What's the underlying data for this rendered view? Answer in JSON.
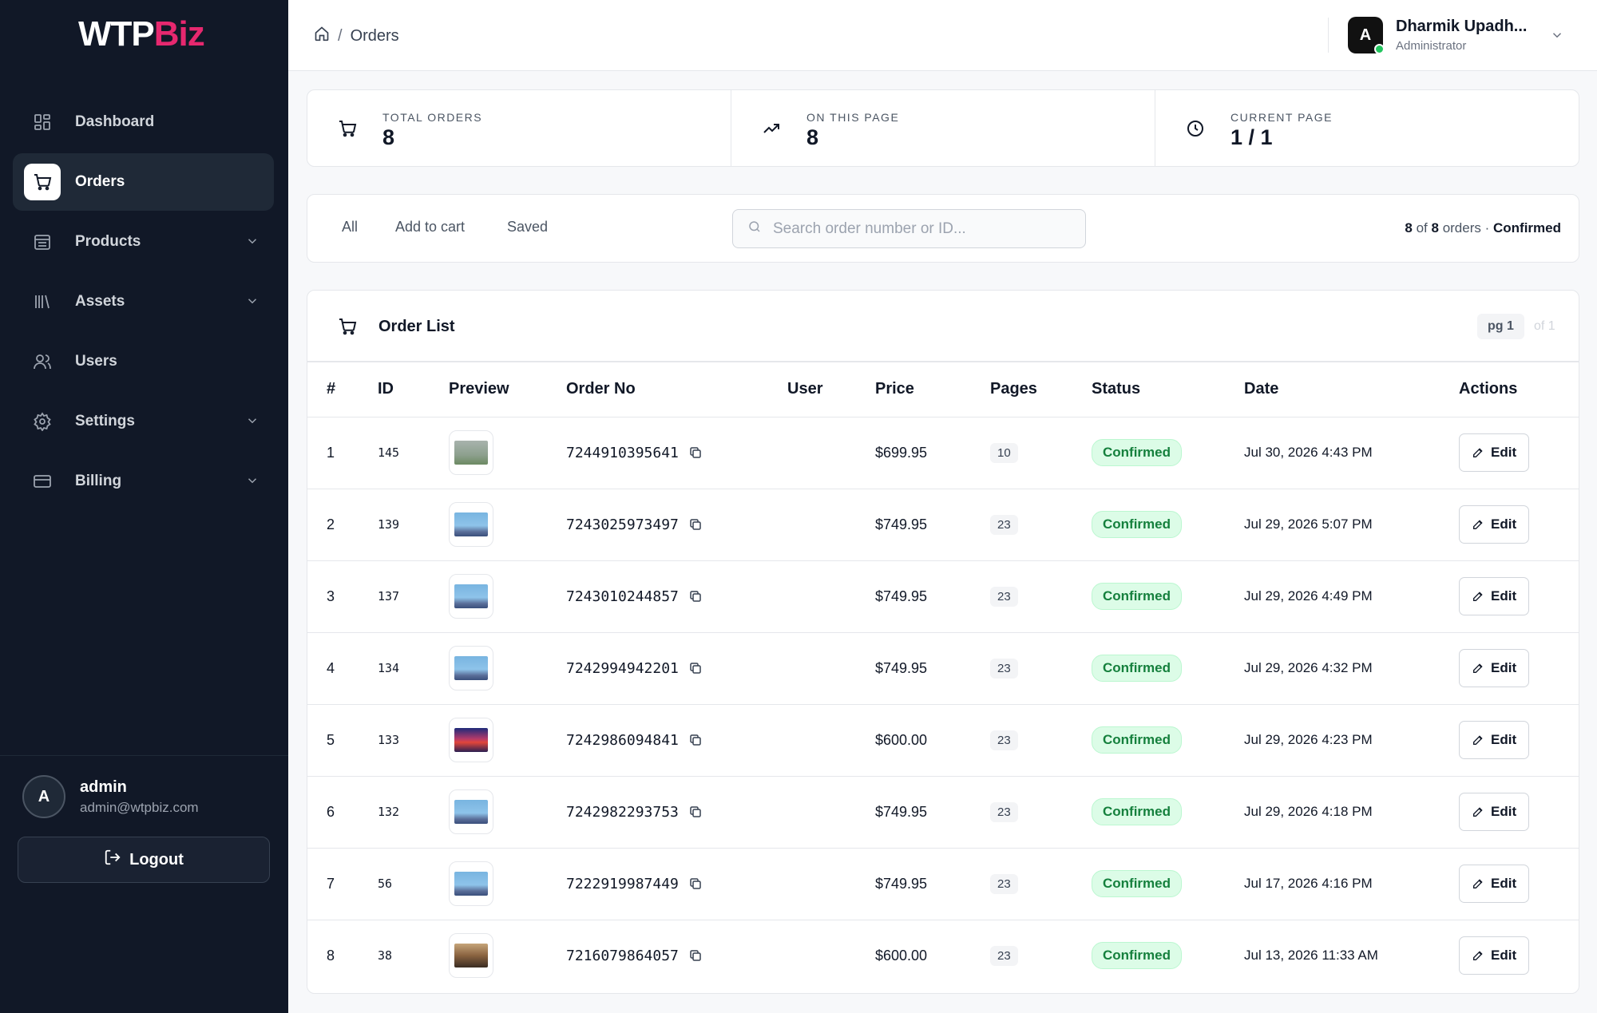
{
  "brand": {
    "part1": "WTP",
    "part2": "Biz"
  },
  "sidebar": {
    "items": [
      {
        "label": "Dashboard",
        "icon": "grid-icon",
        "expandable": false,
        "active": false
      },
      {
        "label": "Orders",
        "icon": "cart-icon",
        "expandable": false,
        "active": true
      },
      {
        "label": "Products",
        "icon": "box-icon",
        "expandable": true,
        "active": false
      },
      {
        "label": "Assets",
        "icon": "library-icon",
        "expandable": true,
        "active": false
      },
      {
        "label": "Users",
        "icon": "users-icon",
        "expandable": false,
        "active": false
      },
      {
        "label": "Settings",
        "icon": "gear-icon",
        "expandable": true,
        "active": false
      },
      {
        "label": "Billing",
        "icon": "card-icon",
        "expandable": true,
        "active": false
      }
    ],
    "account": {
      "initial": "A",
      "name": "admin",
      "email": "admin@wtpbiz.com"
    },
    "logout_label": "Logout"
  },
  "breadcrumb": {
    "current": "Orders"
  },
  "user": {
    "initial": "A",
    "name": "Dharmik Upadh...",
    "role": "Administrator"
  },
  "stats": [
    {
      "label": "TOTAL ORDERS",
      "value": "8",
      "icon": "cart-icon"
    },
    {
      "label": "ON THIS PAGE",
      "value": "8",
      "icon": "trend-up-icon"
    },
    {
      "label": "CURRENT PAGE",
      "value": "1 / 1",
      "icon": "clock-icon"
    }
  ],
  "filters": {
    "tabs": [
      "All",
      "Add to cart",
      "Saved"
    ],
    "search_placeholder": "Search order number or ID...",
    "count_shown": "8",
    "count_of": " of ",
    "count_total": "8",
    "count_suffix": " orders",
    "status_label": "Confirmed"
  },
  "order_list": {
    "title": "Order List",
    "page_badge": "pg 1",
    "page_of": "of 1",
    "columns": [
      "#",
      "ID",
      "Preview",
      "Order No",
      "User",
      "Price",
      "Pages",
      "Status",
      "Date",
      "Actions"
    ],
    "rows": [
      {
        "n": "1",
        "id": "145",
        "preview": "land",
        "order_no": "7244910395641",
        "user": "",
        "price": "$699.95",
        "pages": "10",
        "status": "Confirmed",
        "date": "Jul 30, 2026 4:43 PM",
        "action": "Edit"
      },
      {
        "n": "2",
        "id": "139",
        "preview": "sky",
        "order_no": "7243025973497",
        "user": "",
        "price": "$749.95",
        "pages": "23",
        "status": "Confirmed",
        "date": "Jul 29, 2026 5:07 PM",
        "action": "Edit"
      },
      {
        "n": "3",
        "id": "137",
        "preview": "sky",
        "order_no": "7243010244857",
        "user": "",
        "price": "$749.95",
        "pages": "23",
        "status": "Confirmed",
        "date": "Jul 29, 2026 4:49 PM",
        "action": "Edit"
      },
      {
        "n": "4",
        "id": "134",
        "preview": "sky",
        "order_no": "7242994942201",
        "user": "",
        "price": "$749.95",
        "pages": "23",
        "status": "Confirmed",
        "date": "Jul 29, 2026 4:32 PM",
        "action": "Edit"
      },
      {
        "n": "5",
        "id": "133",
        "preview": "sunset",
        "order_no": "7242986094841",
        "user": "",
        "price": "$600.00",
        "pages": "23",
        "status": "Confirmed",
        "date": "Jul 29, 2026 4:23 PM",
        "action": "Edit"
      },
      {
        "n": "6",
        "id": "132",
        "preview": "sky",
        "order_no": "7242982293753",
        "user": "",
        "price": "$749.95",
        "pages": "23",
        "status": "Confirmed",
        "date": "Jul 29, 2026 4:18 PM",
        "action": "Edit"
      },
      {
        "n": "7",
        "id": "56",
        "preview": "sky",
        "order_no": "7222919987449",
        "user": "",
        "price": "$749.95",
        "pages": "23",
        "status": "Confirmed",
        "date": "Jul 17, 2026 4:16 PM",
        "action": "Edit"
      },
      {
        "n": "8",
        "id": "38",
        "preview": "moto",
        "order_no": "7216079864057",
        "user": "",
        "price": "$600.00",
        "pages": "23",
        "status": "Confirmed",
        "date": "Jul 13, 2026 11:33 AM",
        "action": "Edit"
      }
    ]
  },
  "colors": {
    "sidebar_bg": "#111827",
    "brand_accent": "#e6286f",
    "status_green": "#15803d",
    "online_dot": "#22c55e"
  }
}
